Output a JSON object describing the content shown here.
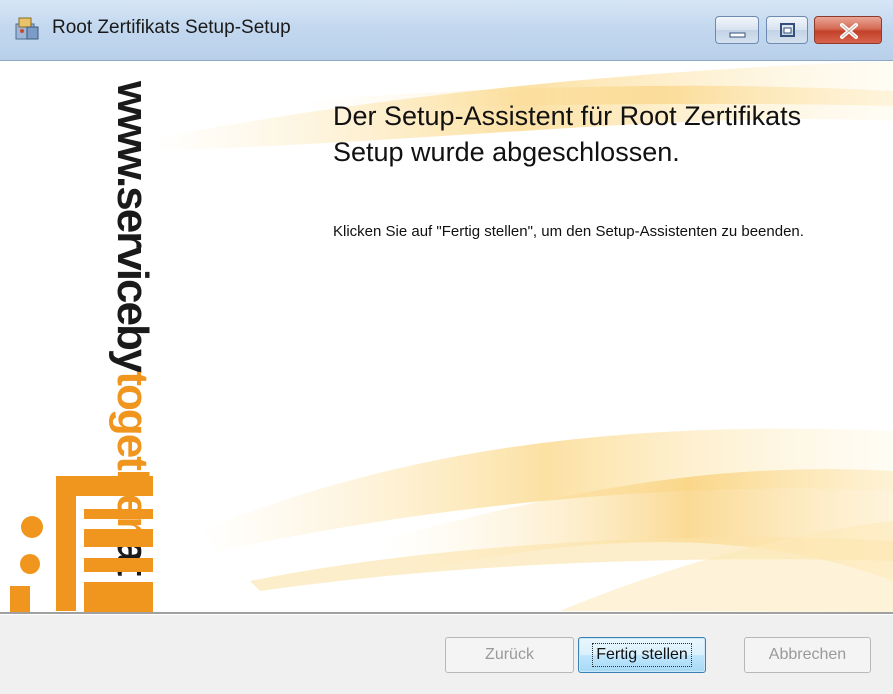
{
  "window": {
    "title": "Root Zertifikats Setup-Setup",
    "icons": {
      "app": "installer-icon",
      "minimize": "minimize-icon",
      "maximize": "maximize-icon",
      "close": "close-icon"
    }
  },
  "branding": {
    "logo_text_prefix": "www.serviceby",
    "logo_text_highlight": "together",
    "logo_text_suffix": ".at",
    "logo_mark": "servicebytogether-logo",
    "colors": {
      "accent": "#f0961e",
      "text": "#1a1a1a"
    }
  },
  "main": {
    "heading": "Der Setup-Assistent für Root Zertifikats Setup wurde abgeschlossen.",
    "body": "Klicken Sie auf \"Fertig stellen\", um den Setup-Assistenten zu beenden."
  },
  "buttons": {
    "back": {
      "label": "Zurück",
      "enabled": false
    },
    "finish": {
      "label": "Fertig stellen",
      "enabled": true
    },
    "cancel": {
      "label": "Abbrechen",
      "enabled": false
    }
  }
}
